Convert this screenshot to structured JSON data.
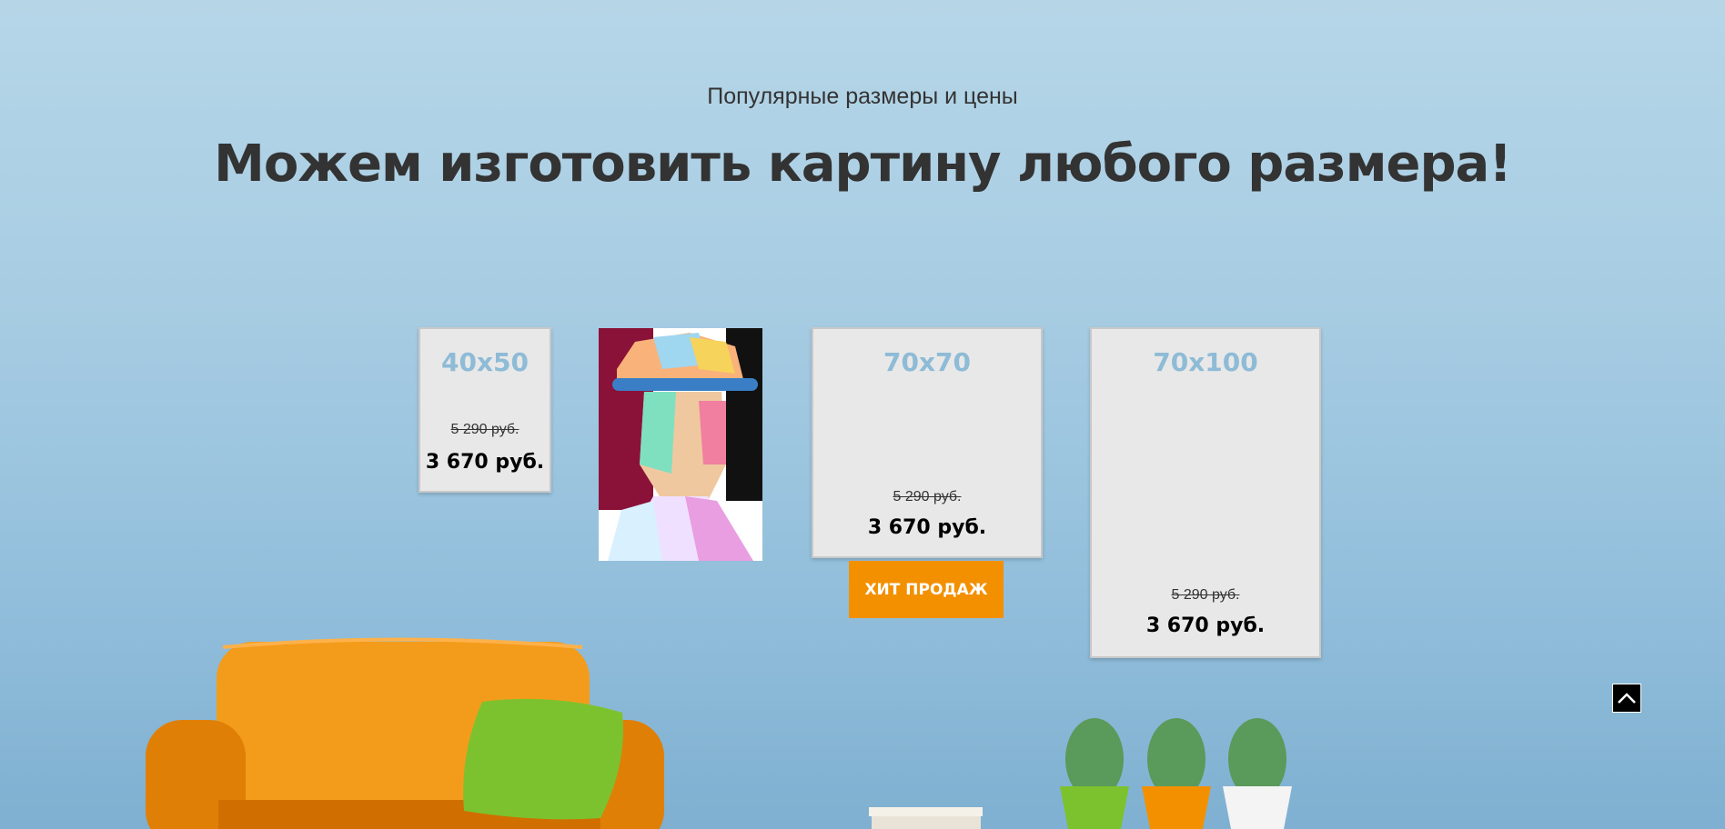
{
  "header": {
    "subtitle": "Популярные размеры и цены",
    "title": "Можем изготовить картину любого размера!"
  },
  "cards": [
    {
      "size": "40x50",
      "old_price": "5 290 руб.",
      "price": "3 670 руб."
    },
    {
      "size": "70x70",
      "old_price": "5 290 руб.",
      "price": "3 670 руб."
    },
    {
      "size": "70x100",
      "old_price": "5 290 руб.",
      "price": "3 670 руб."
    }
  ],
  "badge": {
    "label": "ХИТ ПРОДАЖ"
  },
  "icons": {
    "scroll_top": "chevron-up-icon"
  },
  "colors": {
    "accent": "#f39000",
    "size_label": "#8ebbd6",
    "sofa": "#f08a0a",
    "pillow": "#7cc22e"
  }
}
